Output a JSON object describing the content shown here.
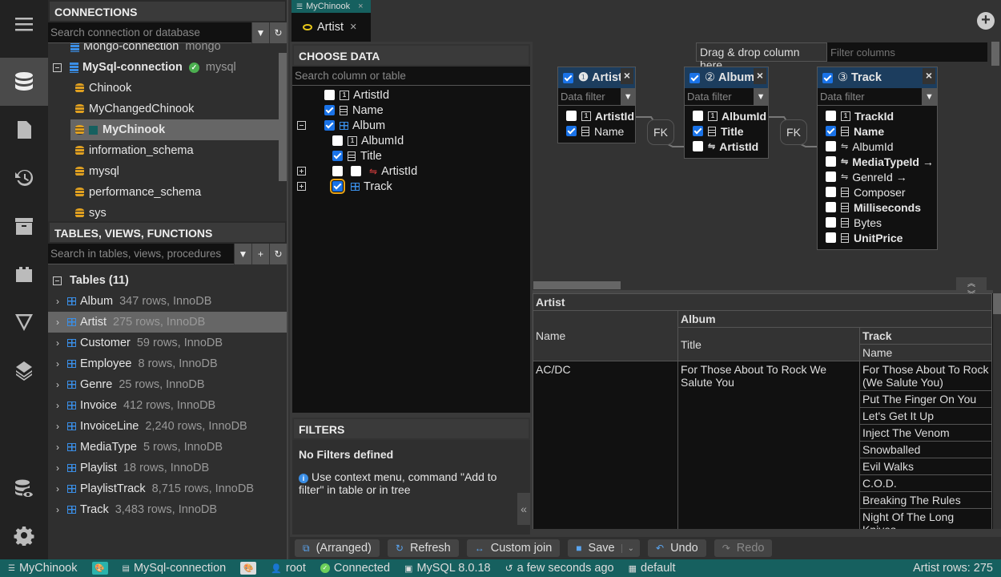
{
  "sidebar_icons": [
    "menu-icon",
    "database-icon",
    "file-icon",
    "history-icon",
    "archive-icon",
    "plugin-icon",
    "filter-icon",
    "layers-icon",
    "database-eye-icon",
    "settings-icon"
  ],
  "connections": {
    "title": "CONNECTIONS",
    "search_placeholder": "Search connection or database",
    "items": [
      {
        "label": "Mongo-connection",
        "engine": "mongo"
      },
      {
        "label": "MySql-connection",
        "engine": "mysql"
      }
    ],
    "databases": [
      "Chinook",
      "MyChangedChinook",
      "MyChinook",
      "information_schema",
      "mysql",
      "performance_schema",
      "sys"
    ],
    "selected_database": "MyChinook"
  },
  "tables_panel": {
    "title": "TABLES, VIEWS, FUNCTIONS",
    "search_placeholder": "Search in tables, views, procedures",
    "group_label": "Tables (11)",
    "tables": [
      {
        "name": "Album",
        "info": "347 rows, InnoDB"
      },
      {
        "name": "Artist",
        "info": "275 rows, InnoDB"
      },
      {
        "name": "Customer",
        "info": "59 rows, InnoDB"
      },
      {
        "name": "Employee",
        "info": "8 rows, InnoDB"
      },
      {
        "name": "Genre",
        "info": "25 rows, InnoDB"
      },
      {
        "name": "Invoice",
        "info": "412 rows, InnoDB"
      },
      {
        "name": "InvoiceLine",
        "info": "2,240 rows, InnoDB"
      },
      {
        "name": "MediaType",
        "info": "5 rows, InnoDB"
      },
      {
        "name": "Playlist",
        "info": "18 rows, InnoDB"
      },
      {
        "name": "PlaylistTrack",
        "info": "8,715 rows, InnoDB"
      },
      {
        "name": "Track",
        "info": "3,483 rows, InnoDB"
      }
    ],
    "selected_table": "Artist"
  },
  "tabs": {
    "db_tab": "MyChinook",
    "view_tab": "Artist",
    "close_glyph": "×"
  },
  "choose_data": {
    "title": "CHOOSE DATA",
    "search_placeholder": "Search column or table",
    "tree": [
      {
        "label": "ArtistId",
        "checked": false
      },
      {
        "label": "Name",
        "checked": true
      },
      {
        "label": "Album",
        "checked": true
      },
      {
        "label": "AlbumId",
        "checked": false
      },
      {
        "label": "Title",
        "checked": true
      },
      {
        "label": "ArtistId",
        "checked": false
      },
      {
        "label": "Track",
        "checked": true
      }
    ]
  },
  "filters": {
    "title": "FILTERS",
    "empty_title": "No Filters defined",
    "hint": "Use context menu, command \"Add to filter\" in table or in tree",
    "collapse_glyph": "«"
  },
  "designer": {
    "drop_hint": "Drag & drop column here",
    "filter_columns_placeholder": "Filter columns",
    "data_filter_placeholder": "Data filter",
    "fk_label": "FK",
    "tables": [
      {
        "number": "❶",
        "name": "Artist",
        "columns": [
          {
            "name": "ArtistId",
            "checked": false
          },
          {
            "name": "Name",
            "checked": true
          }
        ]
      },
      {
        "number": "②",
        "name": "Album",
        "columns": [
          {
            "name": "AlbumId",
            "checked": false
          },
          {
            "name": "Title",
            "checked": true
          },
          {
            "name": "ArtistId",
            "checked": false
          }
        ]
      },
      {
        "number": "③",
        "name": "Track",
        "columns": [
          {
            "name": "TrackId",
            "checked": false
          },
          {
            "name": "Name",
            "checked": true
          },
          {
            "name": "AlbumId",
            "checked": false
          },
          {
            "name": "MediaTypeId →",
            "checked": false
          },
          {
            "name": "GenreId →",
            "checked": false
          },
          {
            "name": "Composer",
            "checked": false
          },
          {
            "name": "Milliseconds",
            "checked": false
          },
          {
            "name": "Bytes",
            "checked": false
          },
          {
            "name": "UnitPrice",
            "checked": false
          }
        ]
      }
    ]
  },
  "grid": {
    "headers": {
      "artist": "Artist",
      "album": "Album",
      "track": "Track",
      "name": "Name",
      "title": "Title",
      "track_name": "Name"
    },
    "artist_name": "AC/DC",
    "album_title": "For Those About To Rock We Salute You",
    "tracks": [
      "For Those About To Rock (We Salute You)",
      "Put The Finger On You",
      "Let's Get It Up",
      "Inject The Venom",
      "Snowballed",
      "Evil Walks",
      "C.O.D.",
      "Breaking The Rules",
      "Night Of The Long Knives"
    ]
  },
  "toolbar": {
    "arrange": "(Arranged)",
    "refresh": "Refresh",
    "custom_join": "Custom join",
    "save": "Save",
    "undo": "Undo",
    "redo": "Redo"
  },
  "statusbar": {
    "database": "MyChinook",
    "connection": "MySql-connection",
    "user": "root",
    "status": "Connected",
    "server": "MySQL 8.0.18",
    "time": "a few seconds ago",
    "schema": "default",
    "rows": "Artist rows: 275"
  },
  "colors": {
    "statusbar": "#16605f",
    "accent": "#1a73e8",
    "connected": "#4caf50",
    "table_header": "#1c3d5e"
  }
}
